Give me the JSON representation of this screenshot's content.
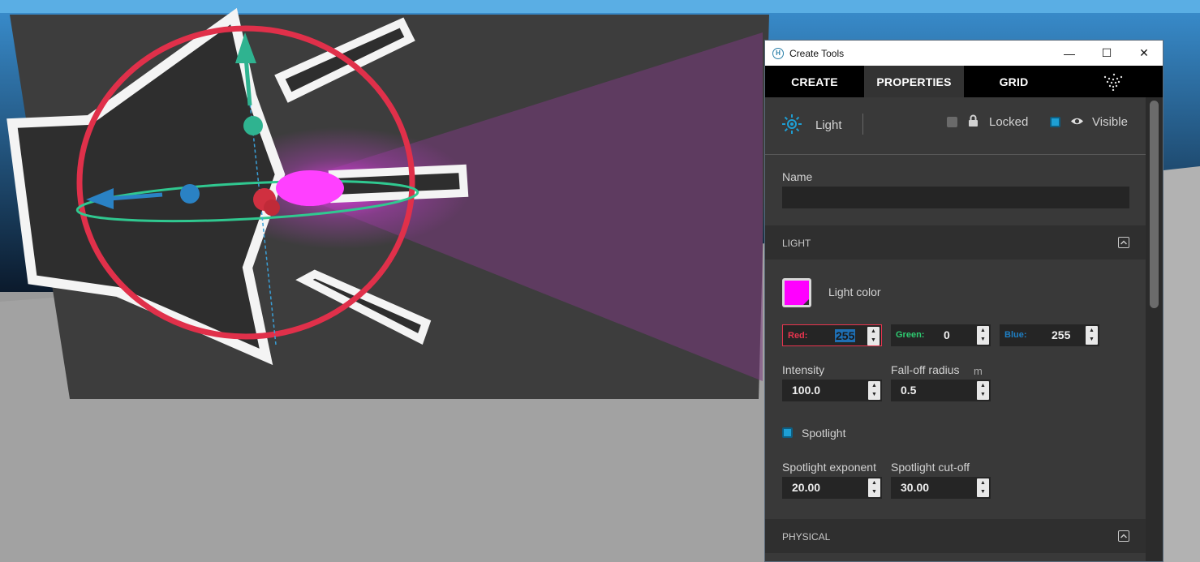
{
  "window": {
    "title": "Create Tools",
    "app_icon": "H",
    "controls": {
      "minimize": "—",
      "maximize": "☐",
      "close": "✕"
    }
  },
  "tabs": [
    {
      "label": "CREATE",
      "active": false
    },
    {
      "label": "PROPERTIES",
      "active": true
    },
    {
      "label": "GRID",
      "active": false
    }
  ],
  "entity": {
    "type_label": "Light",
    "locked_label": "Locked",
    "locked": false,
    "visible_label": "Visible",
    "visible": true
  },
  "name_field": {
    "label": "Name",
    "value": ""
  },
  "light_section": {
    "title": "LIGHT",
    "color_label": "Light color",
    "color": "#ff00ff",
    "red_label": "Red:",
    "red": "255",
    "green_label": "Green:",
    "green": "0",
    "blue_label": "Blue:",
    "blue": "255",
    "intensity_label": "Intensity",
    "intensity": "100.0",
    "falloff_label": "Fall-off radius",
    "falloff_unit": "m",
    "falloff": "0.5",
    "spotlight_label": "Spotlight",
    "spotlight": true,
    "spot_exponent_label": "Spotlight exponent",
    "spot_exponent": "20.00",
    "spot_cutoff_label": "Spotlight cut-off",
    "spot_cutoff": "30.00"
  },
  "physical_section": {
    "title": "PHYSICAL"
  },
  "colors": {
    "accent_blue": "#1e9fd4",
    "red_label": "#e8344e",
    "green_label": "#2ecc71",
    "blue_label": "#1e7fc4"
  }
}
